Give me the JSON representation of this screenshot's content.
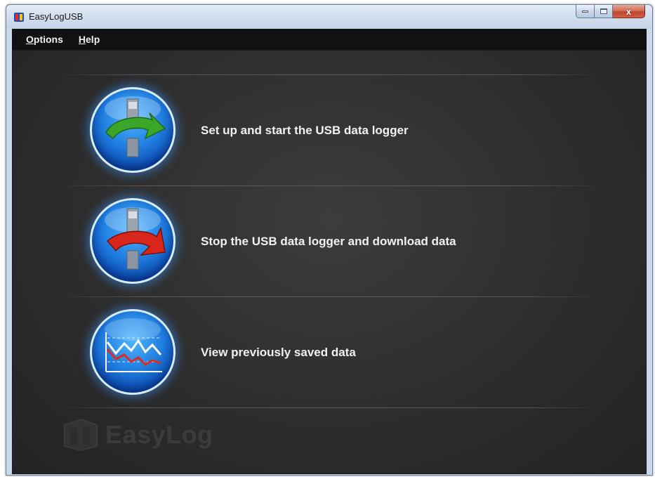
{
  "window": {
    "title": "EasyLogUSB",
    "controls": {
      "minimize": "minimize",
      "maximize": "maximize",
      "close": "x"
    }
  },
  "menu": {
    "items": [
      {
        "label": "Options",
        "hotkey": "O",
        "rest": "ptions"
      },
      {
        "label": "Help",
        "hotkey": "H",
        "rest": "elp"
      }
    ]
  },
  "actions": [
    {
      "label": "Set up and start the USB data logger",
      "icon": "usb-start-icon",
      "arrow_color": "#3aa62a"
    },
    {
      "label": "Stop the USB data logger and download data",
      "icon": "usb-stop-icon",
      "arrow_color": "#d8261c"
    },
    {
      "label": "View previously saved data",
      "icon": "graph-view-icon"
    }
  ],
  "brand": {
    "text": "EasyLog"
  },
  "colors": {
    "accent": "#1f7ee0",
    "background": "#2c2c2c",
    "menubar": "#111111"
  }
}
